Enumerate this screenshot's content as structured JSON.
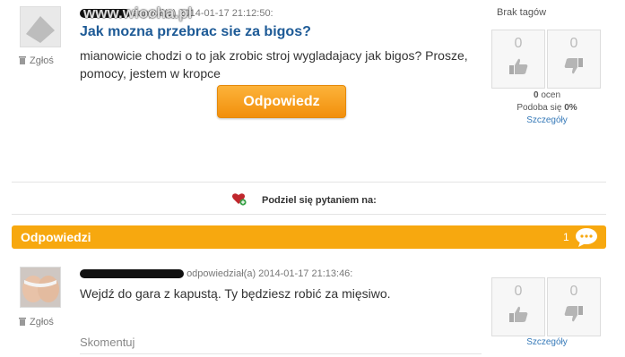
{
  "watermark": "www.wiocha.pl",
  "question": {
    "meta": "zapytał(a) 2014-01-17 21:12:50:",
    "title": "Jak mozna przebrac sie za bigos?",
    "text": "mianowicie chodzi o to jak zrobic stroj wygladajacy jak bigos? Prosze, pomocy, jestem w kropce",
    "report_label": "Zgłoś",
    "answer_button": "Odpowiedz",
    "tags": "Brak tagów",
    "votes": {
      "up": "0",
      "down": "0"
    },
    "ratings_count": "0",
    "ratings_label": "ocen",
    "likes_label": "Podoba się",
    "likes_value": "0%",
    "details_link": "Szczegóły"
  },
  "share": {
    "label": "Podziel się pytaniem na:"
  },
  "answers_bar": {
    "title": "Odpowiedzi",
    "count": "1"
  },
  "answer": {
    "meta": "odpowiedział(a) 2014-01-17 21:13:46:",
    "text": "Wejdź do gara z kapustą. Ty będziesz robić za mięsiwo.",
    "report_label": "Zgłoś",
    "votes": {
      "up": "0",
      "down": "0"
    },
    "details_link": "Szczegóły",
    "comment_placeholder": "Skomentuj"
  },
  "colors": {
    "accent": "#f7a80f",
    "link": "#3579b8",
    "title": "#1d5a96"
  },
  "icons": [
    "report-bin-icon",
    "thumbs-up-icon",
    "thumbs-down-icon",
    "heart-plus-icon",
    "speech-bubble-icon"
  ]
}
